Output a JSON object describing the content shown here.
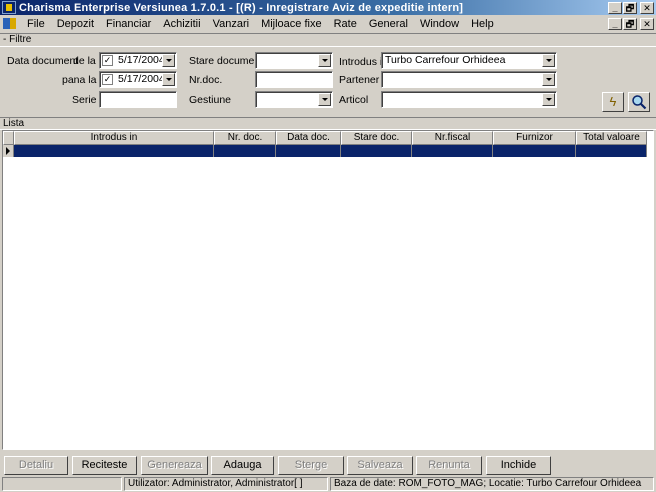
{
  "window": {
    "title": "Charisma Enterprise Versiunea 1.7.0.1 - [(R) - Inregistrare Aviz de expeditie intern]",
    "minimize": "_",
    "restore": "🗗",
    "close": "✕"
  },
  "menu": [
    "File",
    "Depozit",
    "Financiar",
    "Achizitii",
    "Vanzari",
    "Mijloace fixe",
    "Rate",
    "General",
    "Window",
    "Help"
  ],
  "filter": {
    "header": "- Filtre",
    "data_document_label": "Data document",
    "de_la_label": "de la",
    "de_la_checked": "✓",
    "de_la_value": "5/17/2004",
    "pana_la_label": "pana la",
    "pana_la_checked": "✓",
    "pana_la_value": "5/17/2004",
    "serie_label": "Serie",
    "serie_value": "",
    "stare_document_label": "Stare document",
    "stare_document_value": "",
    "nr_doc_label": "Nr.doc.",
    "nr_doc_value": "",
    "gestiune_label": "Gestiune",
    "gestiune_value": "",
    "introdus_in_label": "Introdus in",
    "introdus_in_value": "Turbo Carrefour Orhideea",
    "partener_label": "Partener",
    "partener_value": "",
    "articol_label": "Articol",
    "articol_value": ""
  },
  "list": {
    "header": "Lista",
    "columns": [
      "Introdus in",
      "Nr. doc.",
      "Data doc.",
      "Stare doc.",
      "Nr.fiscal",
      "Furnizor",
      "Total valoare"
    ]
  },
  "buttons": {
    "detaliu": "Detaliu",
    "reciteste": "Reciteste",
    "genereaza": "Genereaza",
    "adauga": "Adauga",
    "sterge": "Sterge",
    "salveaza": "Salveaza",
    "renunta": "Renunta",
    "inchide": "Inchide"
  },
  "status": {
    "user": "Utilizator: Administrator, Administrator[ ]",
    "db": "Baza de date: ROM_FOTO_MAG; Locatie: Turbo Carrefour Orhideea"
  }
}
